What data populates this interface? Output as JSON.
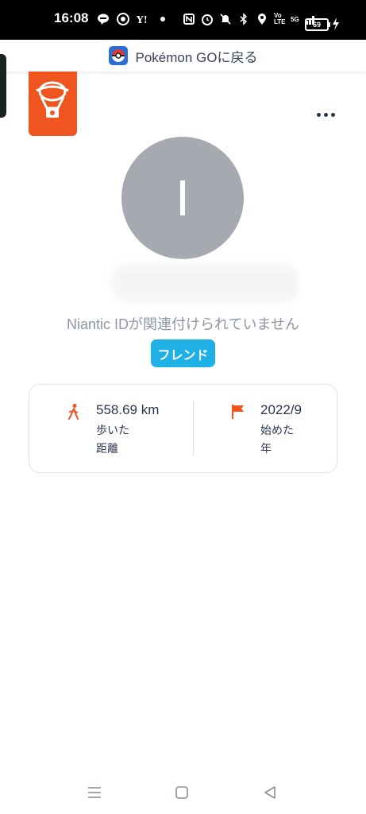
{
  "status_bar": {
    "time": "16:08",
    "network_label": "Vo LTE",
    "signal_label": "5G",
    "battery": "69"
  },
  "return_bar": {
    "label": "Pokémon GOに戻る"
  },
  "profile": {
    "avatar_initial": "I",
    "status_message": "Niantic IDが関連付けられていません",
    "friend_button": "フレンド"
  },
  "stats": {
    "distance": {
      "value": "558.69 km",
      "label_line1": "歩いた",
      "label_line2": "距離"
    },
    "start": {
      "value": "2022/9",
      "label_line1": "始めた",
      "label_line2": "年"
    }
  },
  "colors": {
    "accent_orange": "#f0551f",
    "friend_blue": "#1fb1e6",
    "text_dark": "#2b3550",
    "text_muted": "#8e95a3",
    "avatar_gray": "#a6a9b0"
  },
  "icons": {
    "walk": "walking-person-icon",
    "flag": "flag-icon",
    "more": "more-dots-icon",
    "badge": "campfire-balloon-icon"
  }
}
